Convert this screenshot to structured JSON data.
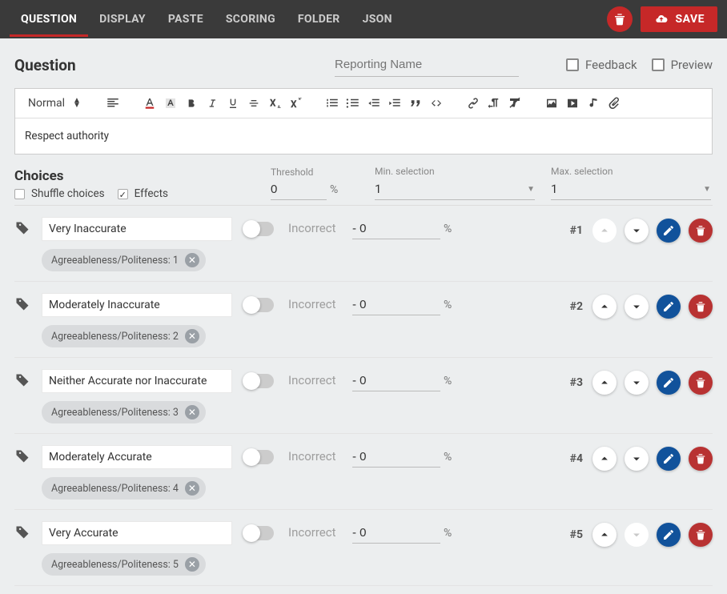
{
  "topbar": {
    "tabs": [
      "QUESTION",
      "DISPLAY",
      "PASTE",
      "SCORING",
      "FOLDER",
      "JSON"
    ],
    "active_tab": 0,
    "save_label": "SAVE"
  },
  "header": {
    "title": "Question",
    "reporting_name_placeholder": "Reporting Name",
    "reporting_name_value": "",
    "feedback_label": "Feedback",
    "feedback_checked": false,
    "preview_label": "Preview",
    "preview_checked": false
  },
  "editor": {
    "format_label": "Normal",
    "content": "Respect authority"
  },
  "choices_header": {
    "title": "Choices",
    "shuffle_label": "Shuffle choices",
    "shuffle_checked": false,
    "effects_label": "Effects",
    "effects_checked": true,
    "threshold_label": "Threshold",
    "threshold_value": "0",
    "percent_symbol": "%",
    "min_label": "Min. selection",
    "min_value": "1",
    "max_label": "Max. selection",
    "max_value": "1"
  },
  "choice_common": {
    "incorrect_label": "Incorrect",
    "score_value": "- 0",
    "percent_symbol": "%"
  },
  "choices": [
    {
      "text": "Very Inaccurate",
      "chip": "Agreeableness/Politeness: 1",
      "num": "#1",
      "up_enabled": false,
      "down_enabled": true
    },
    {
      "text": "Moderately Inaccurate",
      "chip": "Agreeableness/Politeness: 2",
      "num": "#2",
      "up_enabled": true,
      "down_enabled": true
    },
    {
      "text": "Neither Accurate nor Inaccurate",
      "chip": "Agreeableness/Politeness: 3",
      "num": "#3",
      "up_enabled": true,
      "down_enabled": true
    },
    {
      "text": "Moderately Accurate",
      "chip": "Agreeableness/Politeness: 4",
      "num": "#4",
      "up_enabled": true,
      "down_enabled": true
    },
    {
      "text": "Very Accurate",
      "chip": "Agreeableness/Politeness: 5",
      "num": "#5",
      "up_enabled": true,
      "down_enabled": false
    }
  ]
}
